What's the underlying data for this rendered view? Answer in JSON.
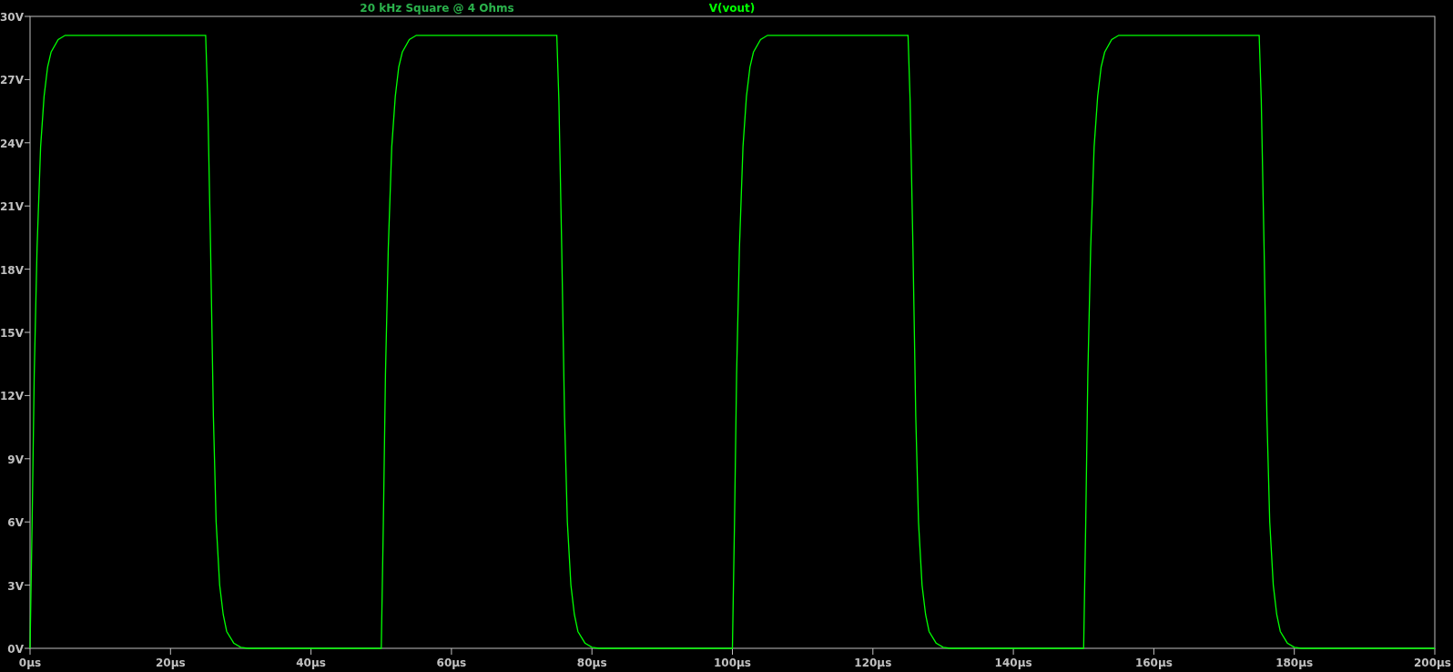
{
  "plot": {
    "chart_data": {
      "type": "line",
      "title": "20 kHz Square @ 4 Ohms",
      "x": [
        0,
        0.3,
        0.6,
        1,
        1.5,
        2,
        2.5,
        3,
        4,
        5,
        25,
        25.3,
        25.7,
        26.1,
        26.5,
        27,
        27.5,
        28,
        29,
        30,
        31,
        50,
        50.3,
        50.6,
        51,
        51.5,
        52,
        52.5,
        53,
        54,
        55,
        75,
        75.3,
        75.7,
        76.1,
        76.5,
        77,
        77.5,
        78,
        79,
        80,
        81,
        100,
        100.3,
        100.6,
        101,
        101.5,
        102,
        102.5,
        103,
        104,
        105,
        125,
        125.3,
        125.7,
        126.1,
        126.5,
        127,
        127.5,
        128,
        129,
        130,
        131,
        150,
        150.3,
        150.6,
        151,
        151.5,
        152,
        152.5,
        153,
        154,
        155,
        175,
        175.3,
        175.7,
        176.1,
        176.5,
        177,
        177.5,
        178,
        179,
        180,
        181,
        200
      ],
      "series": [
        {
          "name": "V(vout)",
          "color": "#00ff00",
          "values": [
            0,
            6,
            13,
            19,
            23.8,
            26.2,
            27.6,
            28.3,
            28.9,
            29.1,
            29.1,
            26,
            19,
            11,
            6,
            3,
            1.6,
            0.8,
            0.25,
            0.05,
            0,
            0,
            6,
            13,
            19,
            23.8,
            26.2,
            27.6,
            28.3,
            28.9,
            29.1,
            29.1,
            26,
            19,
            11,
            6,
            3,
            1.6,
            0.8,
            0.25,
            0.05,
            0,
            0,
            6,
            13,
            19,
            23.8,
            26.2,
            27.6,
            28.3,
            28.9,
            29.1,
            29.1,
            26,
            19,
            11,
            6,
            3,
            1.6,
            0.8,
            0.25,
            0.05,
            0,
            0,
            6,
            13,
            19,
            23.8,
            26.2,
            27.6,
            28.3,
            28.9,
            29.1,
            29.1,
            26,
            19,
            11,
            6,
            3,
            1.6,
            0.8,
            0.25,
            0.05,
            0,
            0
          ]
        }
      ],
      "xlim": [
        0,
        200
      ],
      "ylim": [
        0,
        30
      ],
      "xticks": [
        {
          "value": 0,
          "label": "0µs"
        },
        {
          "value": 20,
          "label": "20µs"
        },
        {
          "value": 40,
          "label": "40µs"
        },
        {
          "value": 60,
          "label": "60µs"
        },
        {
          "value": 80,
          "label": "80µs"
        },
        {
          "value": 100,
          "label": "100µs"
        },
        {
          "value": 120,
          "label": "120µs"
        },
        {
          "value": 140,
          "label": "140µs"
        },
        {
          "value": 160,
          "label": "160µs"
        },
        {
          "value": 180,
          "label": "180µs"
        },
        {
          "value": 200,
          "label": "200µs"
        }
      ],
      "yticks": [
        {
          "value": 0,
          "label": "0V"
        },
        {
          "value": 3,
          "label": "3V"
        },
        {
          "value": 6,
          "label": "6V"
        },
        {
          "value": 9,
          "label": "9V"
        },
        {
          "value": 12,
          "label": "12V"
        },
        {
          "value": 15,
          "label": "15V"
        },
        {
          "value": 18,
          "label": "18V"
        },
        {
          "value": 21,
          "label": "21V"
        },
        {
          "value": 24,
          "label": "24V"
        },
        {
          "value": 27,
          "label": "27V"
        },
        {
          "value": 30,
          "label": "30V"
        }
      ]
    }
  }
}
